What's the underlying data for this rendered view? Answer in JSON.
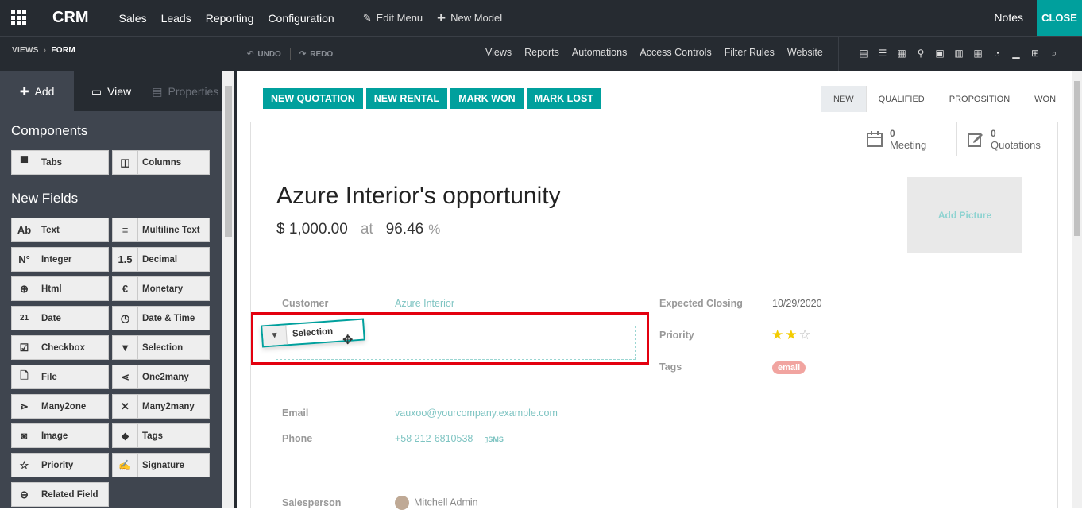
{
  "topbar": {
    "app_name": "CRM",
    "menus": [
      "Sales",
      "Leads",
      "Reporting",
      "Configuration"
    ],
    "edit_menu": "Edit Menu",
    "new_model": "New Model",
    "notes": "Notes",
    "close": "CLOSE"
  },
  "subbar": {
    "breadcrumb": [
      "VIEWS",
      "FORM"
    ],
    "undo": "UNDO",
    "redo": "REDO",
    "links": [
      "Views",
      "Reports",
      "Automations",
      "Access Controls",
      "Filter Rules",
      "Website"
    ],
    "view_icons": [
      "form-view-icon",
      "list-view-icon",
      "kanban-view-icon",
      "map-view-icon",
      "calendar-view-icon",
      "graph-view-icon",
      "pivot-view-icon",
      "dashboard-view-icon",
      "cohort-view-icon",
      "grid-view-icon",
      "search-icon"
    ]
  },
  "sidebar": {
    "tabs": {
      "add": "Add",
      "view": "View",
      "properties": "Properties"
    },
    "components_title": "Components",
    "components": [
      {
        "label": "Tabs",
        "icon": "tabs-icon"
      },
      {
        "label": "Columns",
        "icon": "columns-icon"
      }
    ],
    "new_fields_title": "New Fields",
    "fields": [
      {
        "label": "Text",
        "icon": "Ab"
      },
      {
        "label": "Multiline Text",
        "icon": "≡"
      },
      {
        "label": "Integer",
        "icon": "N°"
      },
      {
        "label": "Decimal",
        "icon": "1.5"
      },
      {
        "label": "Html",
        "icon": "⊕"
      },
      {
        "label": "Monetary",
        "icon": "€"
      },
      {
        "label": "Date",
        "icon": "21"
      },
      {
        "label": "Date & Time",
        "icon": "◷"
      },
      {
        "label": "Checkbox",
        "icon": "☑"
      },
      {
        "label": "Selection",
        "icon": "▼"
      },
      {
        "label": "File",
        "icon": "🗋"
      },
      {
        "label": "One2many",
        "icon": "⋖"
      },
      {
        "label": "Many2one",
        "icon": "⋗"
      },
      {
        "label": "Many2many",
        "icon": "✕"
      },
      {
        "label": "Image",
        "icon": "◙"
      },
      {
        "label": "Tags",
        "icon": "⬥"
      },
      {
        "label": "Priority",
        "icon": "☆"
      },
      {
        "label": "Signature",
        "icon": "✍"
      },
      {
        "label": "Related Field",
        "icon": "⊖"
      }
    ]
  },
  "form": {
    "actions": [
      "NEW QUOTATION",
      "NEW RENTAL",
      "MARK WON",
      "MARK LOST"
    ],
    "stages": [
      "NEW",
      "QUALIFIED",
      "PROPOSITION",
      "WON"
    ],
    "active_stage": "NEW",
    "smart_buttons": [
      {
        "count": "0",
        "label": "Meeting",
        "icon": "calendar-icon"
      },
      {
        "count": "0",
        "label": "Quotations",
        "icon": "edit-icon"
      }
    ],
    "title": "Azure Interior's opportunity",
    "revenue": "$ 1,000.00",
    "at": "at",
    "probability": "96.46",
    "percent": "%",
    "add_picture": "Add Picture",
    "customer_label": "Customer",
    "customer_value": "Azure Interior",
    "dragging_field": "Selection",
    "expected_closing_label": "Expected Closing",
    "expected_closing_value": "10/29/2020",
    "priority_label": "Priority",
    "priority_stars": 2,
    "priority_max": 3,
    "tags_label": "Tags",
    "tag_value": "email",
    "email_label": "Email",
    "email_value": "vauxoo@yourcompany.example.com",
    "phone_label": "Phone",
    "phone_value": "+58 212-6810538",
    "sms": "SMS",
    "salesperson_label": "Salesperson",
    "salesperson_value": "Mitchell Admin"
  }
}
